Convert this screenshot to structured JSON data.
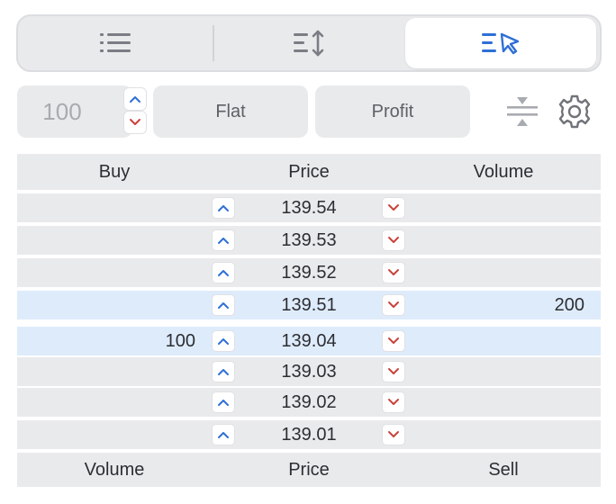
{
  "modes": [
    {
      "name": "list-mode",
      "icon": "list-icon",
      "active": false
    },
    {
      "name": "sort-mode",
      "icon": "sort-arrows-icon",
      "active": false
    },
    {
      "name": "click-trade-mode",
      "icon": "list-cursor-icon",
      "active": true
    }
  ],
  "quantity": {
    "value": "100"
  },
  "actions": {
    "flat_label": "Flat",
    "profit_label": "Profit"
  },
  "toolbar_icons": [
    "center-price-icon",
    "gear-icon"
  ],
  "colors": {
    "accent": "#2f6fd6",
    "sell_arrow": "#c9423a",
    "highlight": "#deebfb",
    "panel": "#e9eaec"
  },
  "book": {
    "header": {
      "left": "Buy",
      "middle": "Price",
      "right": "Volume"
    },
    "footer": {
      "left": "Volume",
      "middle": "Price",
      "right": "Sell"
    },
    "asks": [
      {
        "price": "139.54",
        "sell_volume": ""
      },
      {
        "price": "139.53",
        "sell_volume": ""
      },
      {
        "price": "139.52",
        "sell_volume": ""
      },
      {
        "price": "139.51",
        "sell_volume": "200"
      }
    ],
    "bids": [
      {
        "price": "139.04",
        "buy_volume": "100"
      },
      {
        "price": "139.03",
        "buy_volume": ""
      },
      {
        "price": "139.02",
        "buy_volume": ""
      },
      {
        "price": "139.01",
        "buy_volume": ""
      }
    ]
  }
}
